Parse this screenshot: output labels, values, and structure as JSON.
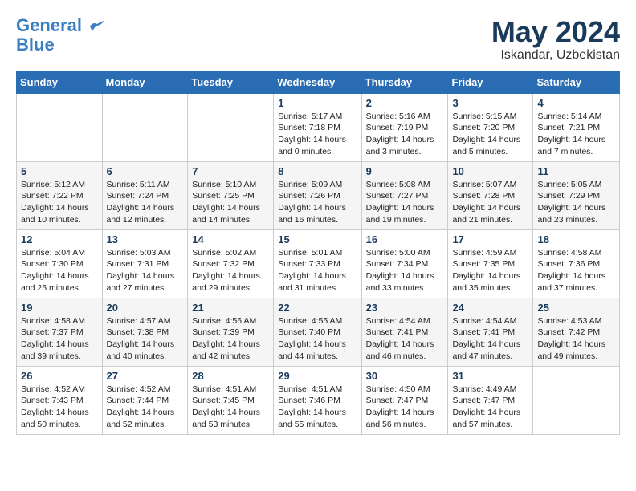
{
  "header": {
    "logo_line1": "General",
    "logo_line2": "Blue",
    "month_year": "May 2024",
    "location": "Iskandar, Uzbekistan"
  },
  "weekdays": [
    "Sunday",
    "Monday",
    "Tuesday",
    "Wednesday",
    "Thursday",
    "Friday",
    "Saturday"
  ],
  "weeks": [
    [
      {
        "day": "",
        "info": ""
      },
      {
        "day": "",
        "info": ""
      },
      {
        "day": "",
        "info": ""
      },
      {
        "day": "1",
        "info": "Sunrise: 5:17 AM\nSunset: 7:18 PM\nDaylight: 14 hours\nand 0 minutes."
      },
      {
        "day": "2",
        "info": "Sunrise: 5:16 AM\nSunset: 7:19 PM\nDaylight: 14 hours\nand 3 minutes."
      },
      {
        "day": "3",
        "info": "Sunrise: 5:15 AM\nSunset: 7:20 PM\nDaylight: 14 hours\nand 5 minutes."
      },
      {
        "day": "4",
        "info": "Sunrise: 5:14 AM\nSunset: 7:21 PM\nDaylight: 14 hours\nand 7 minutes."
      }
    ],
    [
      {
        "day": "5",
        "info": "Sunrise: 5:12 AM\nSunset: 7:22 PM\nDaylight: 14 hours\nand 10 minutes."
      },
      {
        "day": "6",
        "info": "Sunrise: 5:11 AM\nSunset: 7:24 PM\nDaylight: 14 hours\nand 12 minutes."
      },
      {
        "day": "7",
        "info": "Sunrise: 5:10 AM\nSunset: 7:25 PM\nDaylight: 14 hours\nand 14 minutes."
      },
      {
        "day": "8",
        "info": "Sunrise: 5:09 AM\nSunset: 7:26 PM\nDaylight: 14 hours\nand 16 minutes."
      },
      {
        "day": "9",
        "info": "Sunrise: 5:08 AM\nSunset: 7:27 PM\nDaylight: 14 hours\nand 19 minutes."
      },
      {
        "day": "10",
        "info": "Sunrise: 5:07 AM\nSunset: 7:28 PM\nDaylight: 14 hours\nand 21 minutes."
      },
      {
        "day": "11",
        "info": "Sunrise: 5:05 AM\nSunset: 7:29 PM\nDaylight: 14 hours\nand 23 minutes."
      }
    ],
    [
      {
        "day": "12",
        "info": "Sunrise: 5:04 AM\nSunset: 7:30 PM\nDaylight: 14 hours\nand 25 minutes."
      },
      {
        "day": "13",
        "info": "Sunrise: 5:03 AM\nSunset: 7:31 PM\nDaylight: 14 hours\nand 27 minutes."
      },
      {
        "day": "14",
        "info": "Sunrise: 5:02 AM\nSunset: 7:32 PM\nDaylight: 14 hours\nand 29 minutes."
      },
      {
        "day": "15",
        "info": "Sunrise: 5:01 AM\nSunset: 7:33 PM\nDaylight: 14 hours\nand 31 minutes."
      },
      {
        "day": "16",
        "info": "Sunrise: 5:00 AM\nSunset: 7:34 PM\nDaylight: 14 hours\nand 33 minutes."
      },
      {
        "day": "17",
        "info": "Sunrise: 4:59 AM\nSunset: 7:35 PM\nDaylight: 14 hours\nand 35 minutes."
      },
      {
        "day": "18",
        "info": "Sunrise: 4:58 AM\nSunset: 7:36 PM\nDaylight: 14 hours\nand 37 minutes."
      }
    ],
    [
      {
        "day": "19",
        "info": "Sunrise: 4:58 AM\nSunset: 7:37 PM\nDaylight: 14 hours\nand 39 minutes."
      },
      {
        "day": "20",
        "info": "Sunrise: 4:57 AM\nSunset: 7:38 PM\nDaylight: 14 hours\nand 40 minutes."
      },
      {
        "day": "21",
        "info": "Sunrise: 4:56 AM\nSunset: 7:39 PM\nDaylight: 14 hours\nand 42 minutes."
      },
      {
        "day": "22",
        "info": "Sunrise: 4:55 AM\nSunset: 7:40 PM\nDaylight: 14 hours\nand 44 minutes."
      },
      {
        "day": "23",
        "info": "Sunrise: 4:54 AM\nSunset: 7:41 PM\nDaylight: 14 hours\nand 46 minutes."
      },
      {
        "day": "24",
        "info": "Sunrise: 4:54 AM\nSunset: 7:41 PM\nDaylight: 14 hours\nand 47 minutes."
      },
      {
        "day": "25",
        "info": "Sunrise: 4:53 AM\nSunset: 7:42 PM\nDaylight: 14 hours\nand 49 minutes."
      }
    ],
    [
      {
        "day": "26",
        "info": "Sunrise: 4:52 AM\nSunset: 7:43 PM\nDaylight: 14 hours\nand 50 minutes."
      },
      {
        "day": "27",
        "info": "Sunrise: 4:52 AM\nSunset: 7:44 PM\nDaylight: 14 hours\nand 52 minutes."
      },
      {
        "day": "28",
        "info": "Sunrise: 4:51 AM\nSunset: 7:45 PM\nDaylight: 14 hours\nand 53 minutes."
      },
      {
        "day": "29",
        "info": "Sunrise: 4:51 AM\nSunset: 7:46 PM\nDaylight: 14 hours\nand 55 minutes."
      },
      {
        "day": "30",
        "info": "Sunrise: 4:50 AM\nSunset: 7:47 PM\nDaylight: 14 hours\nand 56 minutes."
      },
      {
        "day": "31",
        "info": "Sunrise: 4:49 AM\nSunset: 7:47 PM\nDaylight: 14 hours\nand 57 minutes."
      },
      {
        "day": "",
        "info": ""
      }
    ]
  ]
}
